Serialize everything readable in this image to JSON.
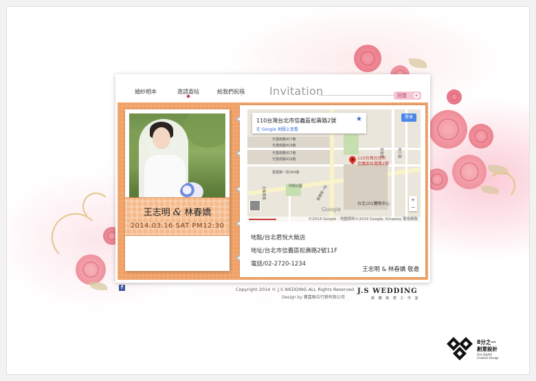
{
  "nav": {
    "items": [
      {
        "label": "婚紗相本",
        "active": false
      },
      {
        "label": "邀請喜帖",
        "active": true
      },
      {
        "label": "給我們祝福",
        "active": false
      }
    ],
    "page_title": "Invitation",
    "back_button": "回首",
    "back_plus": "+"
  },
  "invitation": {
    "bride_groom": "王志明",
    "amp": "&",
    "partner": "林春嬌",
    "datetime": "2014.03.16 SAT PM12:30",
    "venue": "地點/台北君悅大飯店",
    "address": "地址/台北市信義區松壽路2號11F",
    "phone": "電話/02-2720-1234",
    "signoff": "王志明 & 林春嬌 敬邀"
  },
  "map": {
    "info_address": "110台灣台北市信義區松壽路2號",
    "info_link": "在 Google 地圖上查看",
    "login": "登录",
    "pin_label_1": "110台灣台北市",
    "pin_label_2": "信義區松壽路2號",
    "streets": [
      "光復南路417巷",
      "光復南路419巷",
      "光復南路417巷",
      "光復南路419巷",
      "基隆路一段364巷",
      "中興公園",
      "光復南路",
      "基隆路一段",
      "台北101購物中心",
      "松智路",
      "松仁路"
    ],
    "google_logo": "Google",
    "footer": "©2014 Google - 地圖資料©2014 Google, Kingway   使用條款",
    "zoom_in": "+",
    "zoom_out": "−"
  },
  "footer": {
    "fb": "f",
    "copyright": "Copyright 2014 © J.S WEDDING ALL Rights Reserved.",
    "design_by": "Design by 寶嘉聯合行銷有限公司",
    "js_logo": "J.S WEDDING",
    "js_sub": "典 藏 婚 禮 工 作 室"
  },
  "brand": {
    "title_1": "8分之一",
    "title_2": "創意設計",
    "sub_1": "One Eighth",
    "sub_2": "Creative Design"
  },
  "colors": {
    "orange": "#f0a064",
    "pink_accent": "#f5c6d4",
    "red_marker": "#e0342a"
  }
}
